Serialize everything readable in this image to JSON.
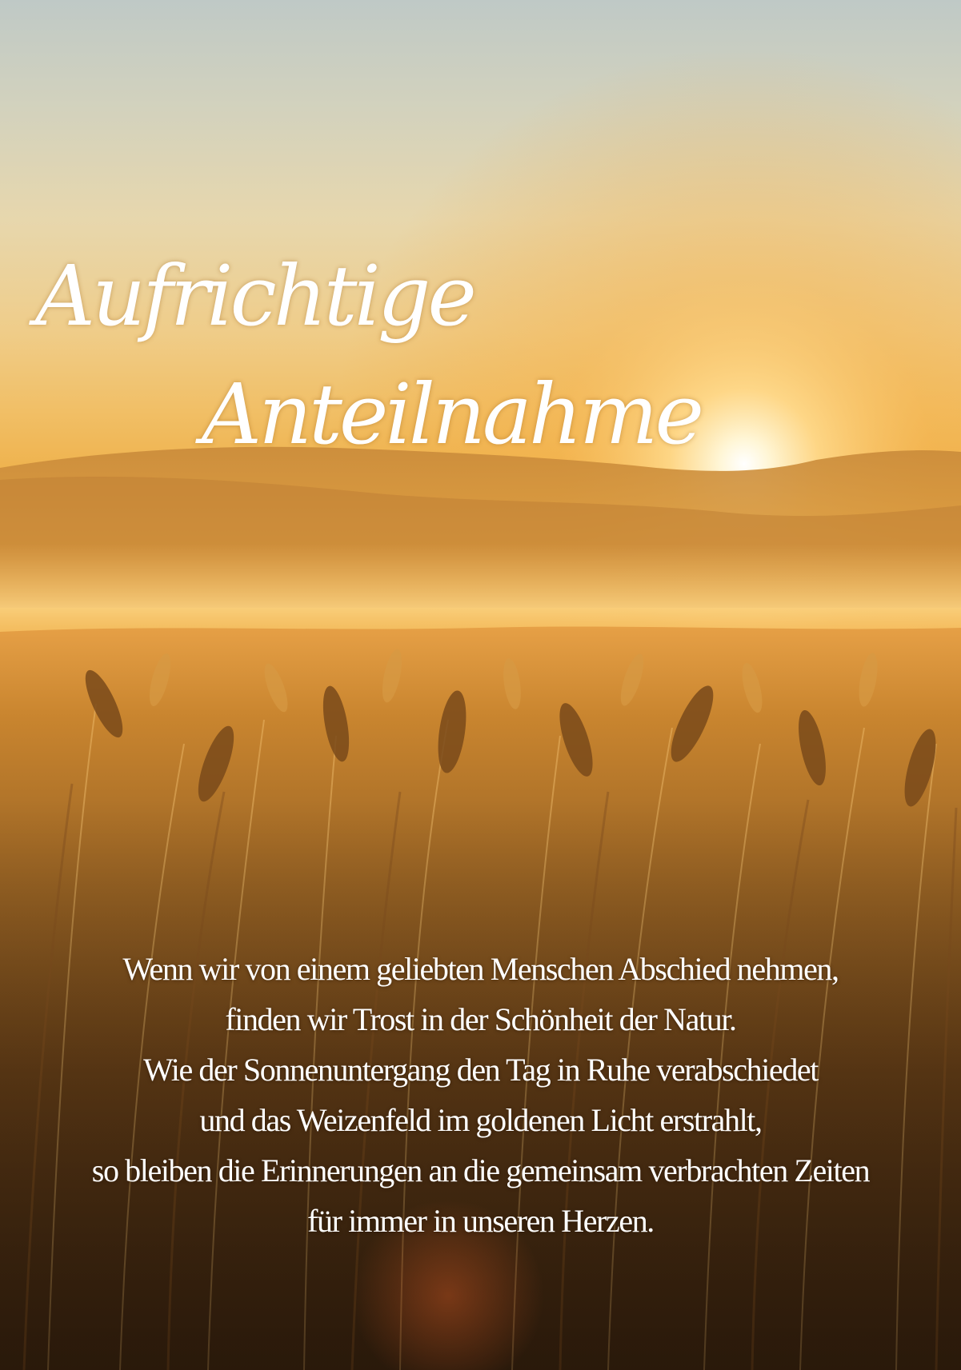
{
  "title": {
    "line1": "Aufrichtige",
    "line2": "Anteilnahme"
  },
  "poem": {
    "lines": [
      "Wenn wir von einem geliebten Menschen Abschied nehmen,",
      "finden wir Trost in der Schönheit der Natur.",
      "Wie der Sonnenuntergang den Tag in Ruhe verabschiedet",
      "und das Weizenfeld im goldenen Licht erstrahlt,",
      "so bleiben die Erinnerungen an die gemeinsam verbrachten Zeiten",
      "für immer in unseren Herzen."
    ]
  },
  "colors": {
    "sky_top": "#bfc9c6",
    "sun_glow": "#ffd98a",
    "wheat_gold": "#c98a2e",
    "foreground_dark": "#3a2410",
    "text": "#ffffff"
  }
}
